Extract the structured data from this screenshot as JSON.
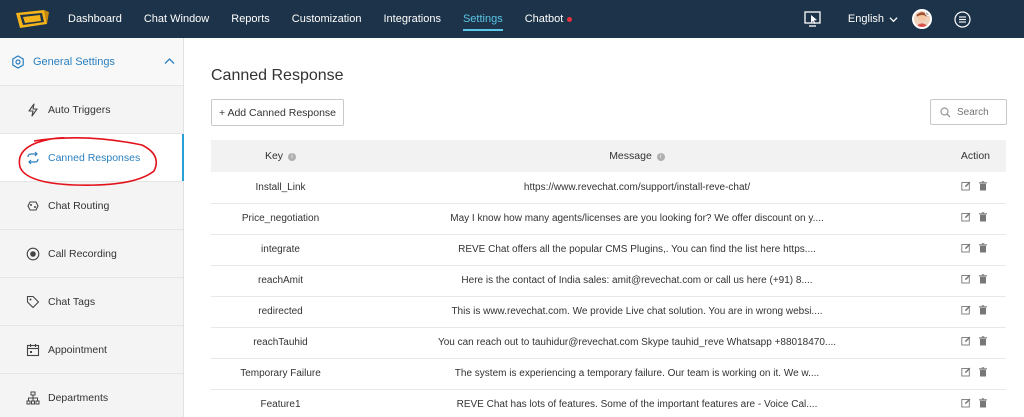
{
  "nav": {
    "items": [
      {
        "label": "Dashboard"
      },
      {
        "label": "Chat Window"
      },
      {
        "label": "Reports"
      },
      {
        "label": "Customization"
      },
      {
        "label": "Integrations"
      },
      {
        "label": "Settings",
        "active": true
      },
      {
        "label": "Chatbot",
        "dot": true
      }
    ],
    "language": "English",
    "accent": "#5bc6e6",
    "background": "#1d3349"
  },
  "sidebar": {
    "header": "General Settings",
    "items": [
      {
        "label": "Auto Triggers",
        "icon": "lightning-icon"
      },
      {
        "label": "Canned Responses",
        "icon": "swap-arrows-icon",
        "active": true
      },
      {
        "label": "Chat Routing",
        "icon": "routing-icon"
      },
      {
        "label": "Call Recording",
        "icon": "record-icon"
      },
      {
        "label": "Chat Tags",
        "icon": "tag-icon"
      },
      {
        "label": "Appointment",
        "icon": "calendar-icon"
      },
      {
        "label": "Departments",
        "icon": "sitemap-icon"
      }
    ]
  },
  "main": {
    "title": "Canned Response",
    "add_button": "+ Add Canned Response",
    "search_placeholder": "Search",
    "table": {
      "headers": {
        "key": "Key",
        "message": "Message",
        "action": "Action"
      },
      "rows": [
        {
          "key": "Install_Link",
          "message": "https://www.revechat.com/support/install-reve-chat/"
        },
        {
          "key": "Price_negotiation",
          "message": "May I know how many agents/licenses are you looking for? We offer discount on y...."
        },
        {
          "key": "integrate",
          "message": "REVE Chat offers all the popular CMS Plugins,. You can find the list here https...."
        },
        {
          "key": "reachAmit",
          "message": "Here is the contact of India sales: amit@revechat.com or call us here (+91) 8...."
        },
        {
          "key": "redirected",
          "message": "This is www.revechat.com. We provide Live chat solution. You are in wrong websi...."
        },
        {
          "key": "reachTauhid",
          "message": "You can reach out to tauhidur@revechat.com Skype tauhid_reve Whatsapp +88018470...."
        },
        {
          "key": "Temporary Failure",
          "message": "The system is experiencing a temporary failure. Our team is working on it. We w...."
        },
        {
          "key": "Feature1",
          "message": "REVE Chat has lots of features. Some of the important features are - Voice Cal...."
        }
      ]
    }
  }
}
